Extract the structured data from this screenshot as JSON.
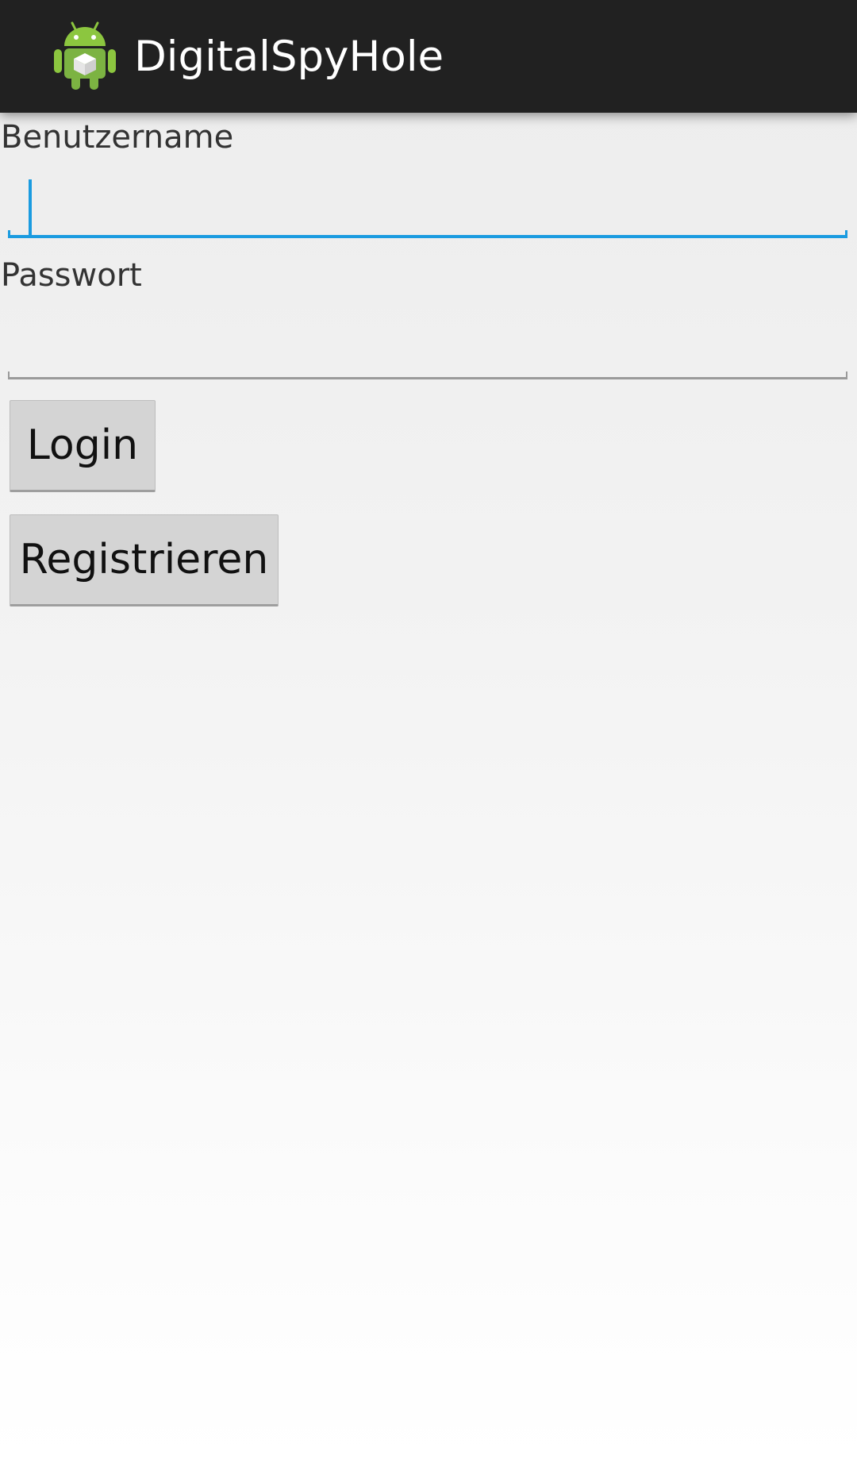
{
  "action_bar": {
    "title": "DigitalSpyHole",
    "icon": "android-robot-icon",
    "background_color": "#212121"
  },
  "form": {
    "username_label": "Benutzername",
    "username_value": "",
    "password_label": "Passwort",
    "password_value": "",
    "focus_color": "#1a9be0"
  },
  "buttons": {
    "login_label": "Login",
    "register_label": "Registrieren"
  }
}
